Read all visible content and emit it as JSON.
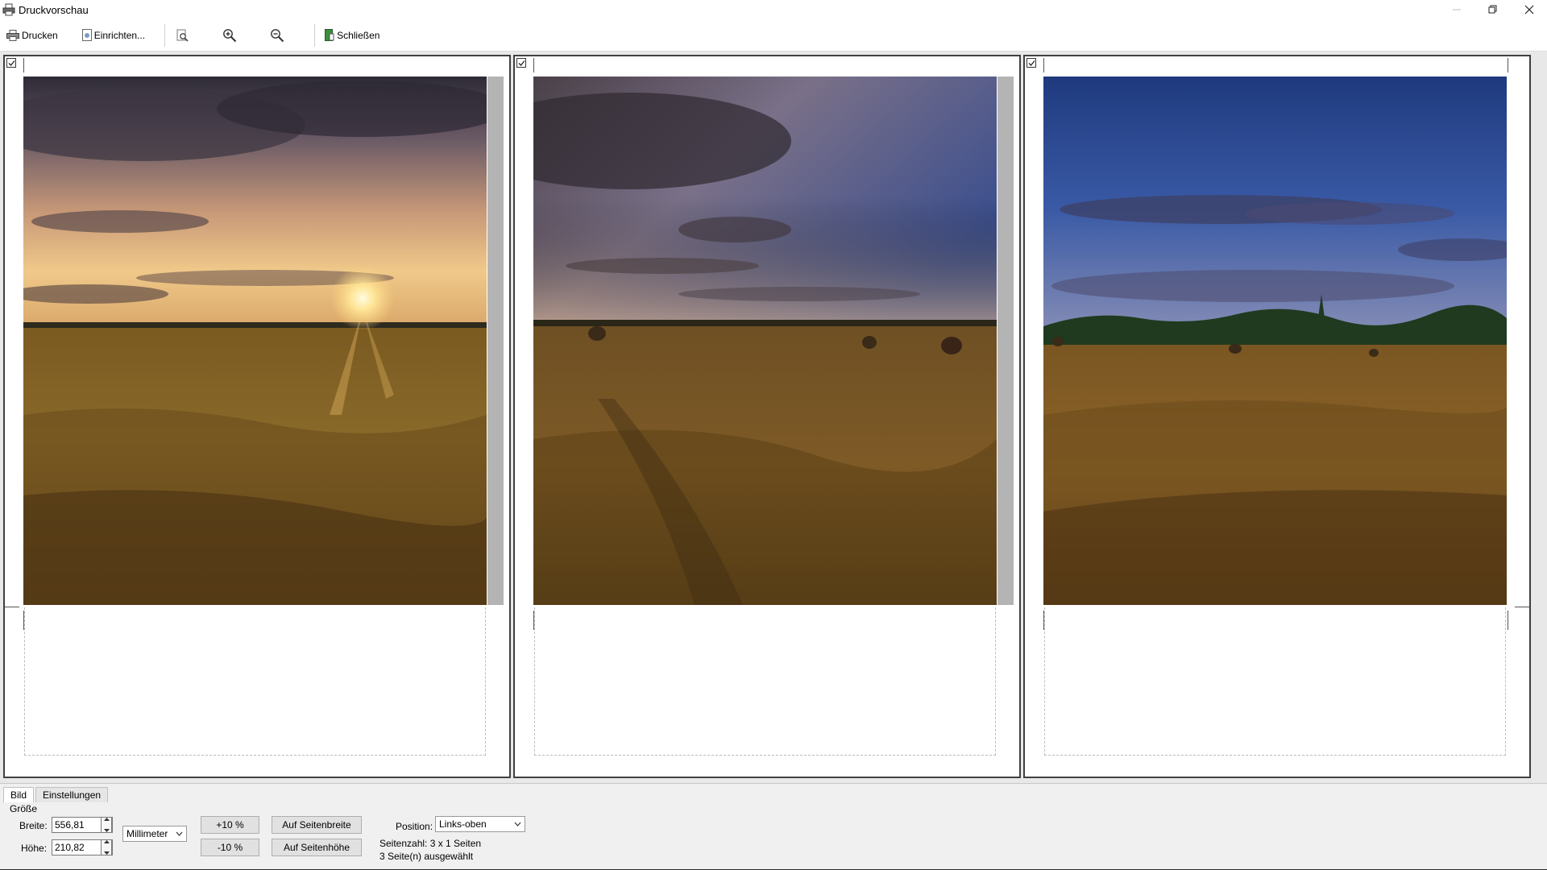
{
  "window": {
    "title": "Druckvorschau",
    "controls": [
      "minimize-icon",
      "restore-icon",
      "close-icon"
    ]
  },
  "toolbar": {
    "print_label": "Drucken",
    "setup_label": "Einrichten...",
    "close_label": "Schließen",
    "zoom_icons": [
      "zoom-fit-icon",
      "zoom-in-icon",
      "zoom-out-icon"
    ]
  },
  "pages": [
    {
      "selected": true,
      "scene": "sunset-field"
    },
    {
      "selected": true,
      "scene": "field-hay-bales"
    },
    {
      "selected": true,
      "scene": "field-treeline"
    }
  ],
  "panel": {
    "tabs": [
      "Bild",
      "Einstellungen"
    ],
    "active_tab": "Bild",
    "group": "Größe",
    "width_label": "Breite:",
    "width_value": "556,81",
    "height_label": "Höhe:",
    "height_value": "210,82",
    "unit": "Millimeter",
    "plus10": "+10 %",
    "minus10": "-10 %",
    "fit_width": "Auf Seitenbreite",
    "fit_height": "Auf Seitenhöhe",
    "position_label": "Position:",
    "position_value": "Links-oben",
    "page_count": "Seitenzahl: 3 x 1 Seiten",
    "pages_selected": "3 Seite(n) ausgewählt"
  },
  "colors": {
    "page_border": "#404040",
    "preview_bg": "#e8e8e8",
    "panel_bg": "#f0f0f0",
    "button_bg": "#e1e1e1"
  }
}
